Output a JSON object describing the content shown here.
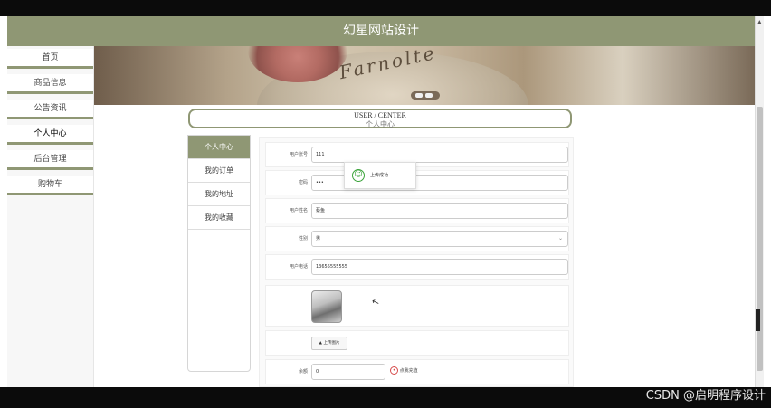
{
  "header": {
    "title": "幻星网站设计"
  },
  "sidebar": {
    "items": [
      {
        "label": "首页"
      },
      {
        "label": "商品信息"
      },
      {
        "label": "公告资讯"
      },
      {
        "label": "个人中心"
      },
      {
        "label": "后台管理"
      },
      {
        "label": "购物车"
      }
    ],
    "active_index": 3
  },
  "banner": {
    "script_text": "Farnolte",
    "carousel_dots": 2
  },
  "section_title": {
    "en": "USER / CENTER",
    "cn": "个人中心"
  },
  "sub_nav": {
    "items": [
      {
        "label": "个人中心"
      },
      {
        "label": "我的订单"
      },
      {
        "label": "我的地址"
      },
      {
        "label": "我的收藏"
      }
    ],
    "active_index": 0
  },
  "form": {
    "account": {
      "label": "用户账号",
      "value": "111"
    },
    "password": {
      "label": "密码",
      "value": "•••"
    },
    "name": {
      "label": "用户姓名",
      "value": "蔡鱼"
    },
    "gender": {
      "label": "性别",
      "value": "男"
    },
    "phone": {
      "label": "用户电话",
      "value": "13655555555"
    },
    "upload": {
      "label": "上传图片"
    },
    "balance": {
      "label": "余额",
      "value": "0",
      "recharge_label": "点我充值"
    }
  },
  "toast": {
    "text": "上传成功"
  },
  "watermark": "CSDN @启明程序设计",
  "colors": {
    "accent": "#8f9774",
    "success": "#3aa33a",
    "danger": "#d64b4b"
  }
}
